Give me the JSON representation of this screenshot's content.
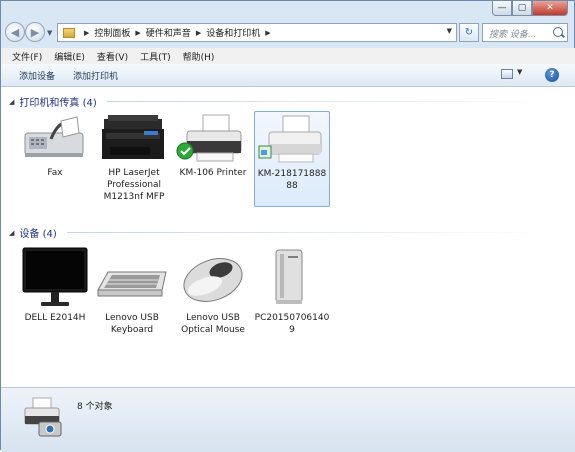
{
  "address": {
    "crumbs": [
      "控制面板",
      "硬件和声音",
      "设备和打印机"
    ]
  },
  "search": {
    "placeholder": "搜索 设备..."
  },
  "menu": [
    "文件(F)",
    "编辑(E)",
    "查看(V)",
    "工具(T)",
    "帮助(H)"
  ],
  "toolbar": {
    "add_device": "添加设备",
    "add_printer": "添加打印机"
  },
  "groups": {
    "printers": {
      "title": "打印机和传真 (4)",
      "items": [
        {
          "label": "Fax",
          "icon": "fax-icon"
        },
        {
          "label": "HP LaserJet Professional M1213nf MFP",
          "icon": "multifunction-printer-icon"
        },
        {
          "label": "KM-106 Printer",
          "icon": "printer-default-icon",
          "default": true
        },
        {
          "label": "KM-21817188888",
          "icon": "printer-icon",
          "selected": true
        }
      ]
    },
    "devices": {
      "title": "设备 (4)",
      "items": [
        {
          "label": "DELL E2014H",
          "icon": "monitor-icon"
        },
        {
          "label": "Lenovo USB Keyboard",
          "icon": "keyboard-icon"
        },
        {
          "label": "Lenovo USB Optical Mouse",
          "icon": "mouse-icon"
        },
        {
          "label": "PC201507061409",
          "icon": "computer-tower-icon"
        }
      ]
    }
  },
  "status": {
    "count": "8 个对象"
  },
  "colors": {
    "accent": "#1e3287",
    "status_bg": "#dde7f2",
    "selection": "#84acdd"
  }
}
